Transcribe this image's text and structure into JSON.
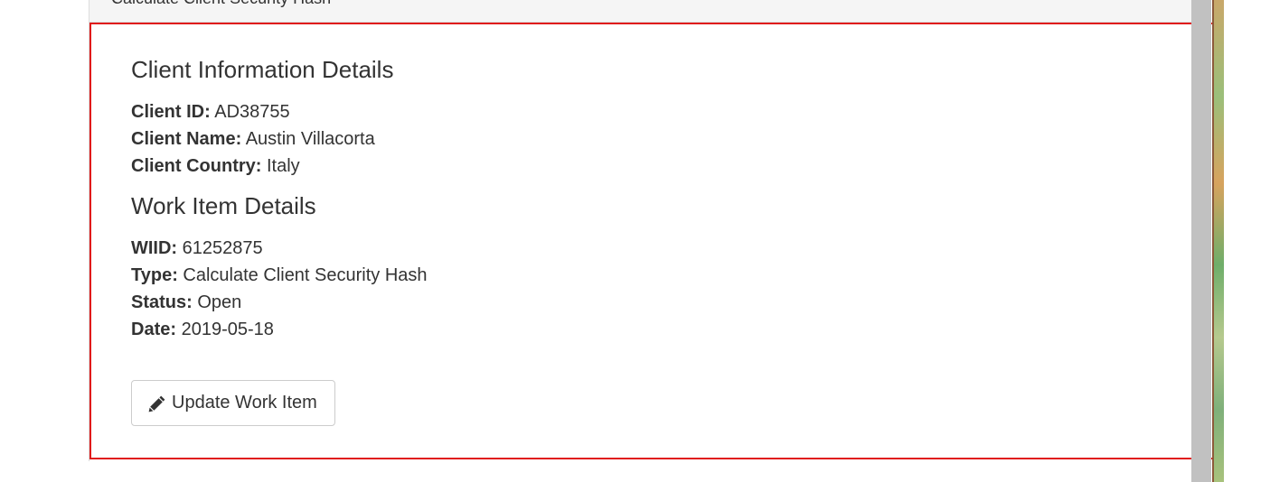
{
  "panel": {
    "heading": "Calculate Client Security Hash"
  },
  "client_section": {
    "title": "Client Information Details",
    "fields": [
      {
        "label": "Client ID:",
        "value": "AD38755"
      },
      {
        "label": "Client Name:",
        "value": "Austin Villacorta"
      },
      {
        "label": "Client Country:",
        "value": "Italy"
      }
    ]
  },
  "work_item_section": {
    "title": "Work Item Details",
    "fields": [
      {
        "label": "WIID:",
        "value": "61252875"
      },
      {
        "label": "Type:",
        "value": "Calculate Client Security Hash"
      },
      {
        "label": "Status:",
        "value": "Open"
      },
      {
        "label": "Date:",
        "value": "2019-05-18"
      }
    ]
  },
  "actions": {
    "update_button_label": "Update Work Item",
    "update_button_icon": "pencil-icon"
  },
  "colors": {
    "highlight_border": "#e01b1b",
    "text": "#333333",
    "panel_heading_bg": "#f5f5f5",
    "scrollbar": "#c1c1c1"
  }
}
